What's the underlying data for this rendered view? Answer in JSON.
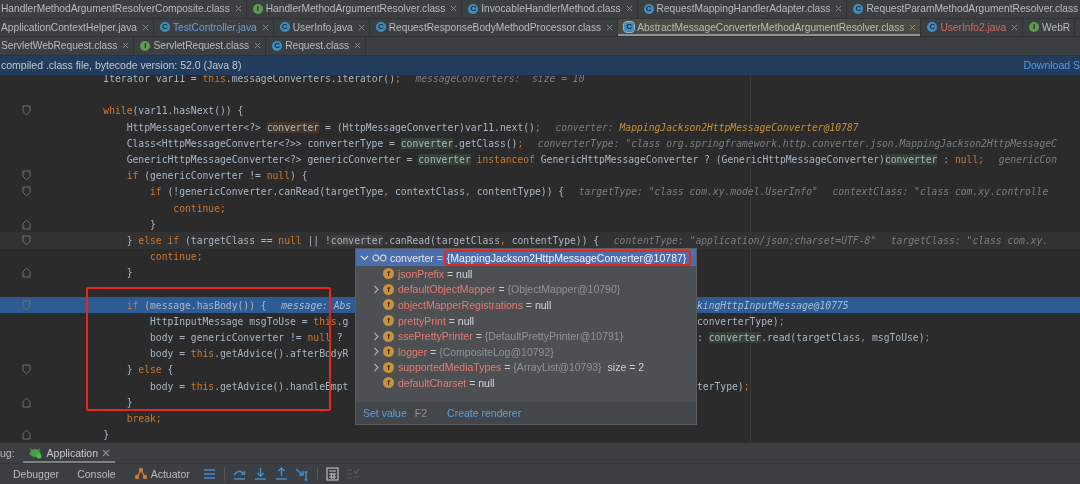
{
  "tab_rows": [
    {
      "tabs": [
        {
          "label": "HandlerMethodArgumentResolverComposite.class",
          "kind": "plain",
          "selected": false,
          "color": "#bbbbbb",
          "closable": true
        },
        {
          "label": "HandlerMethodArgumentResolver.class",
          "kind": "interface",
          "icon_glyph": "I",
          "selected": false,
          "color": "#bbbbbb",
          "closable": true
        },
        {
          "label": "InvocableHandlerMethod.class",
          "kind": "class",
          "icon_glyph": "C",
          "selected": false,
          "color": "#bbbbbb",
          "closable": true
        },
        {
          "label": "RequestMappingHandlerAdapter.class",
          "kind": "class",
          "icon_glyph": "C",
          "selected": false,
          "color": "#bbbbbb",
          "closable": true
        },
        {
          "label": "RequestParamMethodArgumentResolver.class",
          "kind": "class",
          "icon_glyph": "C",
          "selected": false,
          "color": "#bbbbbb",
          "closable": false
        }
      ]
    },
    {
      "tabs": [
        {
          "label": "ApplicationContextHelper.java",
          "kind": "plain",
          "selected": false,
          "color": "#bbbbbb",
          "closable": true
        },
        {
          "label": "TestController.java",
          "kind": "class",
          "icon_glyph": "C",
          "selected": false,
          "color": "#6a9fd4",
          "closable": true
        },
        {
          "label": "UserInfo.java",
          "kind": "class",
          "icon_glyph": "C",
          "selected": false,
          "color": "#bbbbbb",
          "closable": true
        },
        {
          "label": "RequestResponseBodyMethodProcessor.class",
          "kind": "class",
          "icon_glyph": "C",
          "selected": false,
          "color": "#bbbbbb",
          "closable": true
        },
        {
          "label": "AbstractMessageConverterMethodArgumentResolver.class",
          "kind": "abstract",
          "icon_glyph": "C",
          "selected": true,
          "color": "#bbbbbb",
          "closable": true
        },
        {
          "label": "UserInfo2.java",
          "kind": "class",
          "icon_glyph": "C",
          "selected": false,
          "color": "#d8645c",
          "closable": true
        },
        {
          "label": "WebR",
          "kind": "interface",
          "icon_glyph": "I",
          "selected": false,
          "color": "#bbbbbb",
          "closable": false
        }
      ]
    },
    {
      "tabs": [
        {
          "label": "ServletWebRequest.class",
          "kind": "plain",
          "selected": false,
          "color": "#bbbbbb",
          "closable": true
        },
        {
          "label": "ServletRequest.class",
          "kind": "interface",
          "icon_glyph": "I",
          "selected": false,
          "color": "#bbbbbb",
          "closable": true
        },
        {
          "label": "Request.class",
          "kind": "class",
          "icon_glyph": "C",
          "selected": false,
          "color": "#bbbbbb",
          "closable": true
        }
      ]
    }
  ],
  "banner": {
    "text": "compiled .class file, bytecode version: 52.0 (Java 8)",
    "link": "Download S"
  },
  "editor": {
    "lines": [
      {
        "kind": "code",
        "tokens": [
          {
            "kind": "code",
            "text": "Iterator var11 = "
          },
          {
            "kind": "keyword",
            "text": "this"
          },
          {
            "kind": "code",
            "text": ".messageConverters.iterator()"
          },
          {
            "kind": "keyword",
            "text": ";"
          },
          {
            "kind": "hint",
            "text": "messageConverters:  size = 10"
          }
        ]
      },
      {
        "kind": "blank"
      },
      {
        "kind": "code",
        "fold": {
          "kind": "start"
        },
        "tokens": [
          {
            "kind": "keyword",
            "text": "while"
          },
          {
            "kind": "code",
            "text": "(var11.hasNext()) {"
          }
        ],
        "children": [
          {
            "kind": "code",
            "tokens": [
              {
                "kind": "code",
                "text": "HttpMessageConverter<?> "
              },
              {
                "kind": "declaration",
                "text": "converter"
              },
              {
                "kind": "code",
                "text": " = (HttpMessageConverter)var11.next()"
              },
              {
                "kind": "keyword",
                "text": ";"
              },
              {
                "kind": "hint",
                "text": "converter: "
              },
              {
                "kind": "hint-value",
                "text": "MappingJackson2HttpMessageConverter@10787"
              }
            ]
          },
          {
            "kind": "code",
            "tokens": [
              {
                "kind": "code",
                "text": "Class<HttpMessageConverter<?>> converterType = "
              },
              {
                "kind": "usage",
                "text": "converter"
              },
              {
                "kind": "code",
                "text": ".getClass()"
              },
              {
                "kind": "keyword",
                "text": ";"
              },
              {
                "kind": "hint",
                "text": "converterType: \"class org.springframework.http.converter.json.MappingJackson2HttpMessageC"
              }
            ]
          },
          {
            "kind": "code",
            "tokens": [
              {
                "kind": "code",
                "text": "GenericHttpMessageConverter<?> genericConverter = "
              },
              {
                "kind": "usage",
                "text": "converter"
              },
              {
                "kind": "keyword",
                "text": " instanceof"
              },
              {
                "kind": "code",
                "text": " GenericHttpMessageConverter ? (GenericHttpMessageConverter)"
              },
              {
                "kind": "usage",
                "text": "converter"
              },
              {
                "kind": "code",
                "text": " : "
              },
              {
                "kind": "keyword",
                "text": "null;"
              },
              {
                "kind": "hint",
                "text": "genericCon"
              }
            ]
          },
          {
            "kind": "code",
            "fold": {
              "kind": "start"
            },
            "tokens": [
              {
                "kind": "keyword",
                "text": "if"
              },
              {
                "kind": "code",
                "text": " (genericConverter != "
              },
              {
                "kind": "keyword",
                "text": "null"
              },
              {
                "kind": "code",
                "text": ") {"
              }
            ],
            "children": [
              {
                "kind": "code",
                "fold": {
                  "kind": "start"
                },
                "tokens": [
                  {
                    "kind": "keyword",
                    "text": "if"
                  },
                  {
                    "kind": "code",
                    "text": " (!genericConverter.canRead(targetType"
                  },
                  {
                    "kind": "keyword",
                    "text": ","
                  },
                  {
                    "kind": "code",
                    "text": " contextClass"
                  },
                  {
                    "kind": "keyword",
                    "text": ","
                  },
                  {
                    "kind": "code",
                    "text": " contentType)) {"
                  },
                  {
                    "kind": "hint",
                    "text": "targetType: \"class com.xy.model.UserInfo\""
                  },
                  {
                    "kind": "hint",
                    "text": "contextClass: \"class com.xy.controlle"
                  }
                ],
                "children": [
                  {
                    "kind": "code",
                    "tokens": [
                      {
                        "kind": "keyword",
                        "text": "continue;"
                      }
                    ]
                  }
                ]
              },
              {
                "kind": "code",
                "fold": {
                  "kind": "end"
                },
                "tokens": [
                  {
                    "kind": "code",
                    "text": "}"
                  }
                ]
              }
            ]
          },
          {
            "kind": "code",
            "fold": {
              "kind": "start"
            },
            "highlight": {
              "kind": "caret"
            },
            "tokens": [
              {
                "kind": "code",
                "text": "} "
              },
              {
                "kind": "keyword",
                "text": "else if"
              },
              {
                "kind": "code",
                "text": " (targetClass == "
              },
              {
                "kind": "keyword",
                "text": "null"
              },
              {
                "kind": "code",
                "text": " || !"
              },
              {
                "kind": "caret-word",
                "text": "converter"
              },
              {
                "kind": "code",
                "text": ".canRead(targetClass"
              },
              {
                "kind": "keyword",
                "text": ","
              },
              {
                "kind": "code",
                "text": " contentType)) {"
              },
              {
                "kind": "hint",
                "text": "contentType: \"application/json;charset=UTF-8\""
              },
              {
                "kind": "hint",
                "text": "targetClass: \"class com.xy."
              }
            ],
            "children": [
              {
                "kind": "code",
                "tokens": [
                  {
                    "kind": "keyword",
                    "text": "continue;"
                  }
                ]
              }
            ]
          },
          {
            "kind": "code",
            "fold": {
              "kind": "end"
            },
            "tokens": [
              {
                "kind": "code",
                "text": "}"
              }
            ]
          },
          {
            "kind": "blank"
          },
          {
            "kind": "code",
            "fold": {
              "kind": "start"
            },
            "highlight": {
              "kind": "execution"
            },
            "tokens": [
              {
                "kind": "keyword",
                "text": "if"
              },
              {
                "kind": "code",
                "text": " (message.hasBody()) {"
              },
              {
                "kind": "hint",
                "text": "message: Abs"
              }
            ],
            "after": [
              {
                "kind": "hint",
                "text": "kingHttpInputMessage@10775"
              }
            ],
            "children": [
              {
                "kind": "code",
                "tokens": [
                  {
                    "kind": "code",
                    "text": "HttpInputMessage msgToUse = "
                  },
                  {
                    "kind": "keyword",
                    "text": "this"
                  },
                  {
                    "kind": "code",
                    "text": ".g"
                  }
                ],
                "after": [
                  {
                    "kind": "code",
                    "text": "converterType)"
                  },
                  {
                    "kind": "keyword",
                    "text": ";"
                  }
                ]
              },
              {
                "kind": "code",
                "tokens": [
                  {
                    "kind": "code",
                    "text": "body = genericConverter != "
                  },
                  {
                    "kind": "keyword",
                    "text": "null"
                  },
                  {
                    "kind": "code",
                    "text": " ?"
                  }
                ],
                "after": [
                  {
                    "kind": "code",
                    "text": ": "
                  },
                  {
                    "kind": "usage",
                    "text": "converter"
                  },
                  {
                    "kind": "code",
                    "text": ".read(targetClass"
                  },
                  {
                    "kind": "keyword",
                    "text": ","
                  },
                  {
                    "kind": "code",
                    "text": " msgToUse)"
                  },
                  {
                    "kind": "keyword",
                    "text": ";"
                  }
                ]
              },
              {
                "kind": "code",
                "tokens": [
                  {
                    "kind": "code",
                    "text": "body = "
                  },
                  {
                    "kind": "keyword",
                    "text": "this"
                  },
                  {
                    "kind": "code",
                    "text": ".getAdvice().afterBodyR"
                  }
                ]
              }
            ]
          },
          {
            "kind": "code",
            "fold": {
              "kind": "start"
            },
            "tokens": [
              {
                "kind": "code",
                "text": "} "
              },
              {
                "kind": "keyword",
                "text": "else"
              },
              {
                "kind": "code",
                "text": " {"
              }
            ],
            "children": [
              {
                "kind": "code",
                "tokens": [
                  {
                    "kind": "code",
                    "text": "body = "
                  },
                  {
                    "kind": "keyword",
                    "text": "this"
                  },
                  {
                    "kind": "code",
                    "text": ".getAdvice().handleEmpt"
                  }
                ],
                "after": [
                  {
                    "kind": "code",
                    "text": "terType)"
                  },
                  {
                    "kind": "keyword",
                    "text": ";"
                  }
                ]
              }
            ]
          },
          {
            "kind": "code",
            "fold": {
              "kind": "end"
            },
            "tokens": [
              {
                "kind": "code",
                "text": "}"
              }
            ]
          },
          {
            "kind": "code",
            "tokens": [
              {
                "kind": "keyword",
                "text": "break;"
              }
            ]
          }
        ]
      },
      {
        "kind": "code",
        "fold": {
          "kind": "end"
        },
        "tokens": [
          {
            "kind": "code",
            "text": "}"
          }
        ]
      }
    ]
  },
  "variables_popup": {
    "root": {
      "name": "converter",
      "sign": "=",
      "value": "{MappingJackson2HttpMessageConverter@10787}",
      "expanded": true,
      "selected": true,
      "children": [
        {
          "icon_glyph": "f",
          "name": "jsonPrefix",
          "sign": "=",
          "value": "null",
          "kind": "null",
          "expandable": false
        },
        {
          "icon_glyph": "f",
          "name": "defaultObjectMapper",
          "sign": "=",
          "value": "{ObjectMapper@10790}",
          "kind": "object",
          "expandable": true
        },
        {
          "icon_glyph": "f",
          "name": "objectMapperRegistrations",
          "sign": "=",
          "value": "null",
          "kind": "null",
          "expandable": false
        },
        {
          "icon_glyph": "f",
          "name": "prettyPrint",
          "sign": "=",
          "value": "null",
          "kind": "null",
          "expandable": false
        },
        {
          "icon_glyph": "f",
          "name": "ssePrettyPrinter",
          "sign": "=",
          "value": "{DefaultPrettyPrinter@10791}",
          "kind": "object",
          "expandable": true
        },
        {
          "icon_glyph": "f",
          "name": "logger",
          "sign": "=",
          "value": "{CompositeLog@10792}",
          "kind": "object",
          "expandable": true
        },
        {
          "icon_glyph": "f",
          "name": "supportedMediaTypes",
          "sign": "=",
          "value": "{ArrayList@10793}",
          "kind": "object",
          "extra": "size = 2",
          "expandable": true
        },
        {
          "icon_glyph": "f",
          "name": "defaultCharset",
          "sign": "=",
          "value": "null",
          "kind": "null",
          "expandable": false
        }
      ]
    },
    "actions": [
      {
        "label": "Set value",
        "shortcut": "F2"
      },
      {
        "label": "Create renderer"
      }
    ]
  },
  "popup_value_box": {
    "color": "#e8261c"
  },
  "code_block_box": {
    "color": "#e8261c"
  },
  "debug": {
    "title": "ug:",
    "sessions": [
      {
        "label": "Application",
        "selected": true,
        "closable": true
      }
    ],
    "views": [
      {
        "label": "Debugger",
        "kind": "plain"
      },
      {
        "label": "Console",
        "kind": "plain"
      },
      {
        "label": "Actuator",
        "kind": "graph"
      }
    ],
    "actions": [
      {
        "kind": "layout",
        "disabled": false
      },
      {
        "kind": "step-over",
        "disabled": false
      },
      {
        "kind": "step-into",
        "disabled": false
      },
      {
        "kind": "step-out",
        "disabled": false
      },
      {
        "kind": "run-to-cursor",
        "disabled": false
      },
      {
        "kind": "evaluate",
        "disabled": false
      },
      {
        "kind": "trace",
        "disabled": true
      }
    ]
  }
}
